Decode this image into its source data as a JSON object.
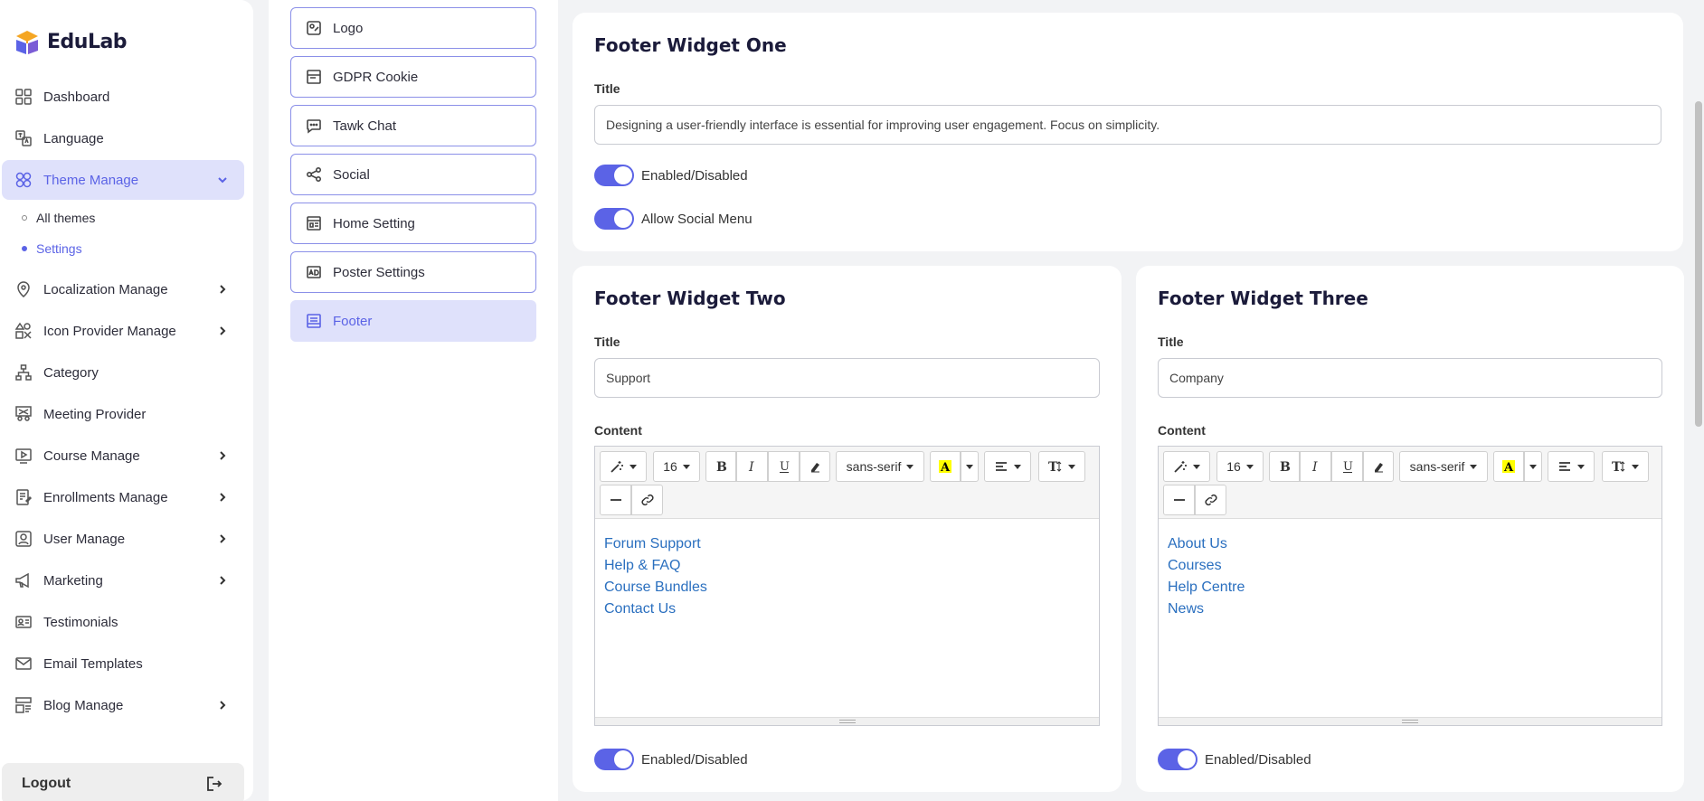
{
  "brand": {
    "name": "EduLab"
  },
  "sidebar": {
    "items": [
      {
        "label": "Dashboard",
        "icon": "dashboard-icon"
      },
      {
        "label": "Language",
        "icon": "language-icon"
      },
      {
        "label": "Theme Manage",
        "icon": "theme-icon",
        "expanded": true
      },
      {
        "label": "Localization Manage",
        "icon": "location-icon"
      },
      {
        "label": "Icon Provider Manage",
        "icon": "icon-provider-icon"
      },
      {
        "label": "Category",
        "icon": "category-icon"
      },
      {
        "label": "Meeting Provider",
        "icon": "meeting-icon"
      },
      {
        "label": "Course Manage",
        "icon": "course-icon"
      },
      {
        "label": "Enrollments Manage",
        "icon": "enrollment-icon"
      },
      {
        "label": "User Manage",
        "icon": "user-icon"
      },
      {
        "label": "Marketing",
        "icon": "megaphone-icon"
      },
      {
        "label": "Testimonials",
        "icon": "testimonial-icon"
      },
      {
        "label": "Email Templates",
        "icon": "mail-icon"
      },
      {
        "label": "Blog Manage",
        "icon": "blog-icon"
      }
    ],
    "subitems": [
      {
        "label": "All themes"
      },
      {
        "label": "Settings",
        "active": true
      }
    ],
    "logout": "Logout"
  },
  "settings_menu": {
    "items": [
      {
        "label": "Logo",
        "icon": "logo-icon"
      },
      {
        "label": "GDPR Cookie",
        "icon": "cookie-icon"
      },
      {
        "label": "Tawk Chat",
        "icon": "chat-icon"
      },
      {
        "label": "Social",
        "icon": "share-icon"
      },
      {
        "label": "Home Setting",
        "icon": "home-setting-icon"
      },
      {
        "label": "Poster Settings",
        "icon": "poster-icon"
      },
      {
        "label": "Footer",
        "icon": "footer-icon",
        "active": true
      }
    ]
  },
  "widget_one": {
    "heading": "Footer Widget One",
    "title_label": "Title",
    "title_value": "Designing a user-friendly interface is essential for improving user engagement. Focus on simplicity.",
    "toggle_enabled": "Enabled/Disabled",
    "toggle_social": "Allow Social Menu"
  },
  "widget_two": {
    "heading": "Footer Widget Two",
    "title_label": "Title",
    "title_value": "Support",
    "content_label": "Content",
    "links": [
      "Forum Support",
      "Help & FAQ",
      "Course Bundles",
      "Contact Us"
    ],
    "toggle_enabled": "Enabled/Disabled"
  },
  "widget_three": {
    "heading": "Footer Widget Three",
    "title_label": "Title",
    "title_value": "Company",
    "content_label": "Content",
    "links": [
      "About Us",
      "Courses",
      "Help Centre",
      "News"
    ],
    "toggle_enabled": "Enabled/Disabled"
  },
  "editor_toolbar": {
    "font_size": "16",
    "font_family": "sans-serif"
  },
  "colors": {
    "accent": "#5b63e6",
    "accent_light": "#dfe1fb",
    "link": "#2a6fbf"
  }
}
